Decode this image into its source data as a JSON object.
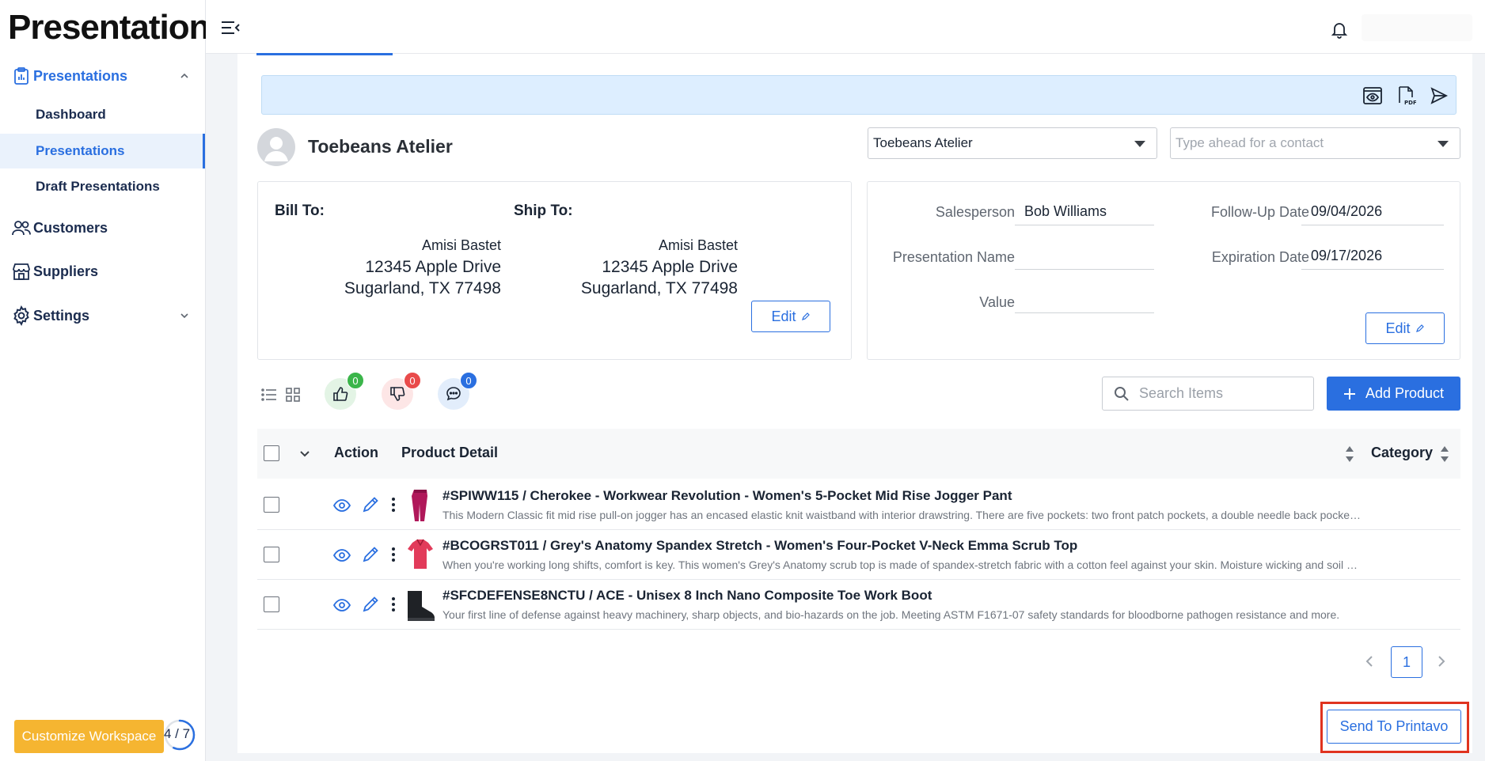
{
  "app": {
    "brand": "Presentations"
  },
  "sidebar": {
    "groups": [
      {
        "label": "Presentations",
        "icon": "clipboard-chart-icon",
        "expanded": true,
        "items": [
          {
            "label": "Dashboard"
          },
          {
            "label": "Presentations",
            "active": true
          },
          {
            "label": "Draft Presentations"
          }
        ]
      },
      {
        "label": "Customers",
        "icon": "users-icon"
      },
      {
        "label": "Suppliers",
        "icon": "store-icon"
      },
      {
        "label": "Settings",
        "icon": "gear-icon",
        "expanded": false
      }
    ],
    "customize_label": "Customize Workspace",
    "progress_text": "4 / 7",
    "progress_fraction": 0.57
  },
  "presentation": {
    "company_name": "Toebeans Atelier",
    "customer_select": "Toebeans Atelier",
    "contact_placeholder": "Type ahead for a contact",
    "bill_to_label": "Bill To:",
    "ship_to_label": "Ship To:",
    "bill_to": {
      "name": "Amisi Bastet",
      "street": "12345 Apple Drive",
      "city": "Sugarland, TX 77498"
    },
    "ship_to": {
      "name": "Amisi Bastet",
      "street": "12345 Apple Drive",
      "city": "Sugarland, TX 77498"
    },
    "edit_label": "Edit",
    "fields": {
      "salesperson_label": "Salesperson",
      "salesperson": "Bob Williams",
      "name_label": "Presentation Name",
      "name": "",
      "value_label": "Value",
      "value": "",
      "followup_label": "Follow-Up Date",
      "followup": "09/04/2026",
      "expiration_label": "Expiration Date",
      "expiration": "09/17/2026"
    }
  },
  "reactions": {
    "likes": "0",
    "dislikes": "0",
    "comments": "0"
  },
  "search": {
    "placeholder": "Search Items"
  },
  "add_product_label": "Add Product",
  "table": {
    "headers": {
      "action": "Action",
      "product_detail": "Product Detail",
      "category": "Category"
    },
    "rows": [
      {
        "title": "#SPIWW115 / Cherokee - Workwear Revolution - Women's 5-Pocket Mid Rise Jogger Pant",
        "desc": "This Modern Classic fit mid rise pull-on jogger has an encased elastic knit waistband with interior drawstring. There are five pockets: two front patch pockets, a double needle back pocket and cargo pocket.",
        "thumb_color": "#b0185a"
      },
      {
        "title": "#BCOGRST011 / Grey's Anatomy Spandex Stretch - Women's Four-Pocket V-Neck Emma Scrub Top",
        "desc": "When you're working long shifts, comfort is key. This women's Grey's Anatomy scrub top is made of spandex-stretch fabric with a cotton feel against your skin. Moisture wicking and soil release.",
        "thumb_color": "#e23b5a"
      },
      {
        "title": "#SFCDEFENSE8NCTU / ACE - Unisex 8 Inch Nano Composite Toe Work Boot",
        "desc": "Your first line of defense against heavy machinery, sharp objects, and bio-hazards on the job. Meeting ASTM F1671-07 safety standards for bloodborne pathogen resistance and more.",
        "thumb_color": "#1f2226"
      }
    ]
  },
  "pagination": {
    "current": "1"
  },
  "send_label": "Send To Printavo",
  "colors": {
    "accent": "#2a6fe0",
    "customize": "#f5b531",
    "highlight": "#e0331f"
  }
}
